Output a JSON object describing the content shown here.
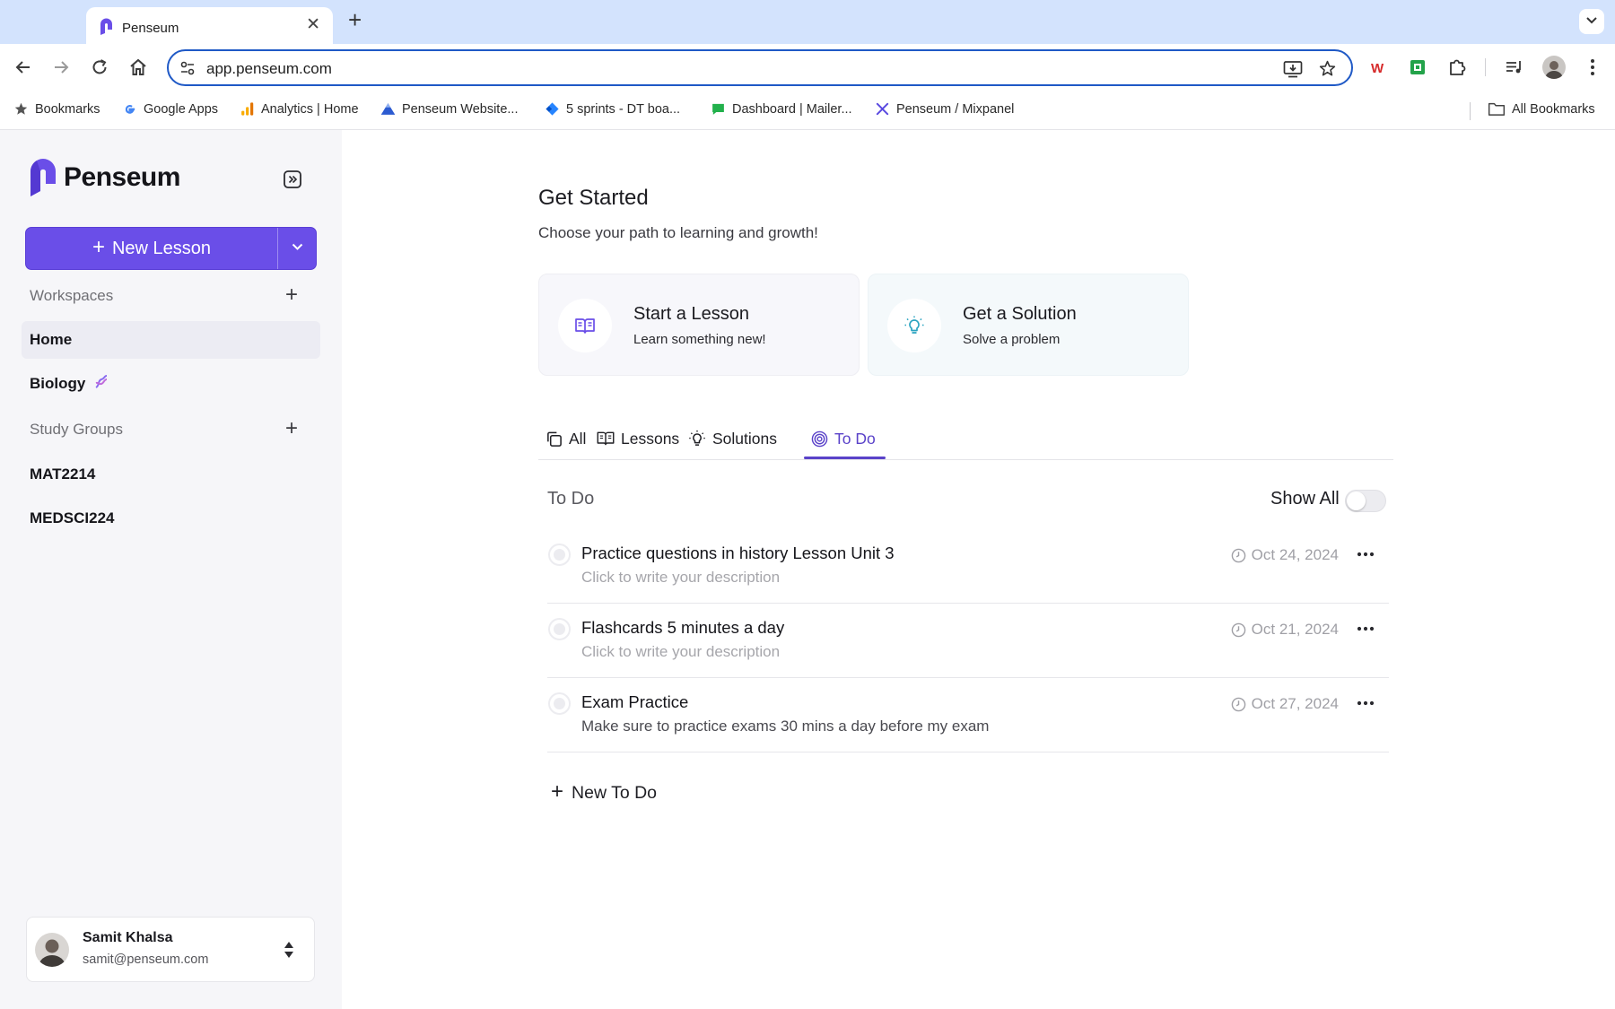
{
  "browser": {
    "tab_title": "Penseum",
    "url": "app.penseum.com",
    "bookmarks": [
      {
        "label": "Bookmarks",
        "icon": "star-icon"
      },
      {
        "label": "Google Apps",
        "icon": "google-icon"
      },
      {
        "label": "Analytics | Home",
        "icon": "analytics-icon"
      },
      {
        "label": "Penseum Website...",
        "icon": "mountain-icon"
      },
      {
        "label": "5 sprints - DT boa...",
        "icon": "jira-icon"
      },
      {
        "label": "Dashboard | Mailer...",
        "icon": "mailer-icon"
      },
      {
        "label": "Penseum / Mixpanel",
        "icon": "mixpanel-icon"
      }
    ],
    "all_bookmarks": "All Bookmarks"
  },
  "sidebar": {
    "logo_text": "Penseum",
    "new_lesson_label": "New Lesson",
    "workspaces_label": "Workspaces",
    "items": [
      {
        "label": "Home"
      },
      {
        "label": "Biology"
      }
    ],
    "study_groups_label": "Study Groups",
    "groups": [
      {
        "label": "MAT2214"
      },
      {
        "label": "MEDSCI224"
      }
    ],
    "user": {
      "name": "Samit Khalsa",
      "email": "samit@penseum.com"
    }
  },
  "main": {
    "title": "Get Started",
    "subtitle": "Choose your path to learning and growth!",
    "cards": [
      {
        "title": "Start a Lesson",
        "subtitle": "Learn something new!"
      },
      {
        "title": "Get a Solution",
        "subtitle": "Solve a problem"
      }
    ],
    "tabs": [
      {
        "label": "All"
      },
      {
        "label": "Lessons"
      },
      {
        "label": "Solutions"
      },
      {
        "label": "To Do"
      }
    ],
    "active_tab": "To Do",
    "todo_heading": "To Do",
    "show_all_label": "Show All",
    "show_all_enabled": false,
    "todos": [
      {
        "title": "Practice questions in history Lesson Unit 3",
        "description": "Click to write your description",
        "date": "Oct 24, 2024"
      },
      {
        "title": "Flashcards 5 minutes a day",
        "description": "Click to write your description",
        "date": "Oct 21, 2024"
      },
      {
        "title": "Exam Practice",
        "description": "Make sure to practice exams 30 mins a day before my exam",
        "date": "Oct 27, 2024"
      }
    ],
    "new_todo_label": "New To Do"
  },
  "colors": {
    "accent": "#6a4ee8",
    "active_tab": "#5a42c9",
    "tabstrip": "#d3e3fd",
    "sidebar_bg": "#f6f6f9"
  }
}
